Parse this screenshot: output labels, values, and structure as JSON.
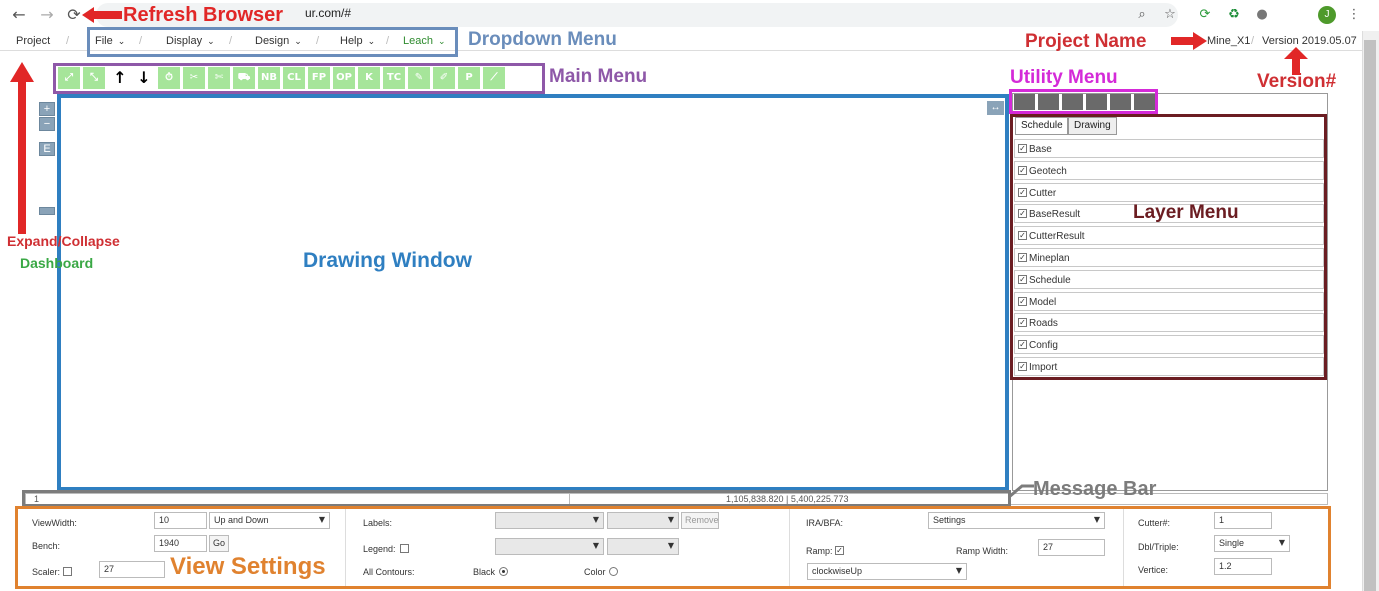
{
  "browser": {
    "url": "ur.com/#",
    "avatar": "J"
  },
  "menubar": {
    "project": "Project",
    "items": [
      {
        "label": "File"
      },
      {
        "label": "Display"
      },
      {
        "label": "Design"
      },
      {
        "label": "Help"
      },
      {
        "label": "Leach"
      }
    ],
    "separator": "/",
    "project_name": "Mine_X1",
    "version": "Version 2019.05.07"
  },
  "toolbar": {
    "tools": [
      "",
      "",
      "↑",
      "↓",
      "",
      "",
      "",
      "",
      "NB",
      "CL",
      "FP",
      "OP",
      "K",
      "TC",
      "",
      "",
      "P",
      ""
    ]
  },
  "dashboard_controls": {
    "zoom_in": "+",
    "zoom_out": "−",
    "extent": "E"
  },
  "tabs": [
    {
      "label": "Schedule"
    },
    {
      "label": "Drawing"
    }
  ],
  "layers": [
    "Base",
    "Geotech",
    "Cutter",
    "BaseResult",
    "CutterResult",
    "Mineplan",
    "Schedule",
    "Model",
    "Roads",
    "Config",
    "Import"
  ],
  "status": {
    "left": "1",
    "coords": "1,105,838.820 | 5,400,225.773"
  },
  "settings": {
    "viewwidth_label": "ViewWidth:",
    "viewwidth_value": "10",
    "direction_value": "Up and Down",
    "bench_label": "Bench:",
    "bench_value": "1940",
    "go_label": "Go",
    "scaler_label": "Scaler:",
    "scaler_value": "27",
    "labels_label": "Labels:",
    "remove_label": "Remove",
    "legend_label": "Legend:",
    "allcontours_label": "All Contours:",
    "black_label": "Black",
    "color_label": "Color",
    "ira_label": "IRA/BFA:",
    "ira_value": "Settings",
    "ramp_label": "Ramp:",
    "rampwidth_label": "Ramp Width:",
    "rampwidth_value": "27",
    "ramp_dir_value": "clockwiseUp",
    "cutter_label": "Cutter#:",
    "cutter_value": "1",
    "dbl_label": "Dbl/Triple:",
    "dbl_value": "Single",
    "vertice_label": "Vertice:",
    "vertice_value": "1.2"
  },
  "annotations": {
    "refresh": "Refresh Browser",
    "dropdown": "Dropdown Menu",
    "main_menu": "Main Menu",
    "project_name": "Project Name",
    "utility_menu": "Utility Menu",
    "version": "Version#",
    "expand_1": "Expand/Collapse",
    "expand_2": "Dashboard",
    "drawing": "Drawing Window",
    "layer_menu": "Layer Menu",
    "message_bar": "Message Bar",
    "view_settings": "View Settings"
  },
  "colors": {
    "refresh": "#e12727",
    "dropdown": "#6a8dbb",
    "main_menu": "#8e58a8",
    "utility": "#d42ad8",
    "layer": "#6b1d22",
    "drawing": "#2f7fc1",
    "expand": "#cf2f33",
    "dashboard": "#3aa845",
    "message": "#7c7c7c",
    "view": "#e0822f",
    "tool_green": "#a6e59a"
  }
}
